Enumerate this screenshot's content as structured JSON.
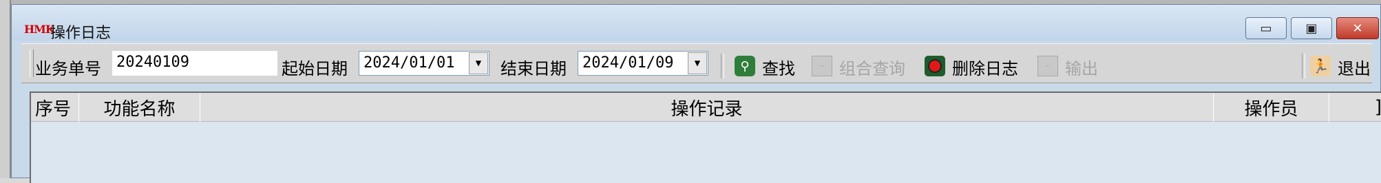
{
  "window": {
    "app_logo": "HMK",
    "title": "操作日志",
    "controls": {
      "minimize": "▭",
      "maximize": "▣",
      "close": "✕"
    }
  },
  "toolbar": {
    "order_no_label": "业务单号",
    "order_no_value": "20240109",
    "start_date_label": "起始日期",
    "start_date_value": "2024/01/01",
    "end_date_label": "结束日期",
    "end_date_value": "2024/01/09",
    "dropdown_arrow": "▼",
    "search_label": "查找",
    "combo_query_label": "组合查询",
    "delete_log_label": "删除日志",
    "export_label": "输出",
    "exit_label": "退出",
    "icons": {
      "search": "search-icon",
      "combo_query": "combo-query-icon",
      "delete_log": "delete-log-icon",
      "export": "export-icon",
      "exit": "exit-icon"
    }
  },
  "grid": {
    "columns": [
      "序号",
      "功能名称",
      "操作记录",
      "操作员",
      "]"
    ]
  }
}
